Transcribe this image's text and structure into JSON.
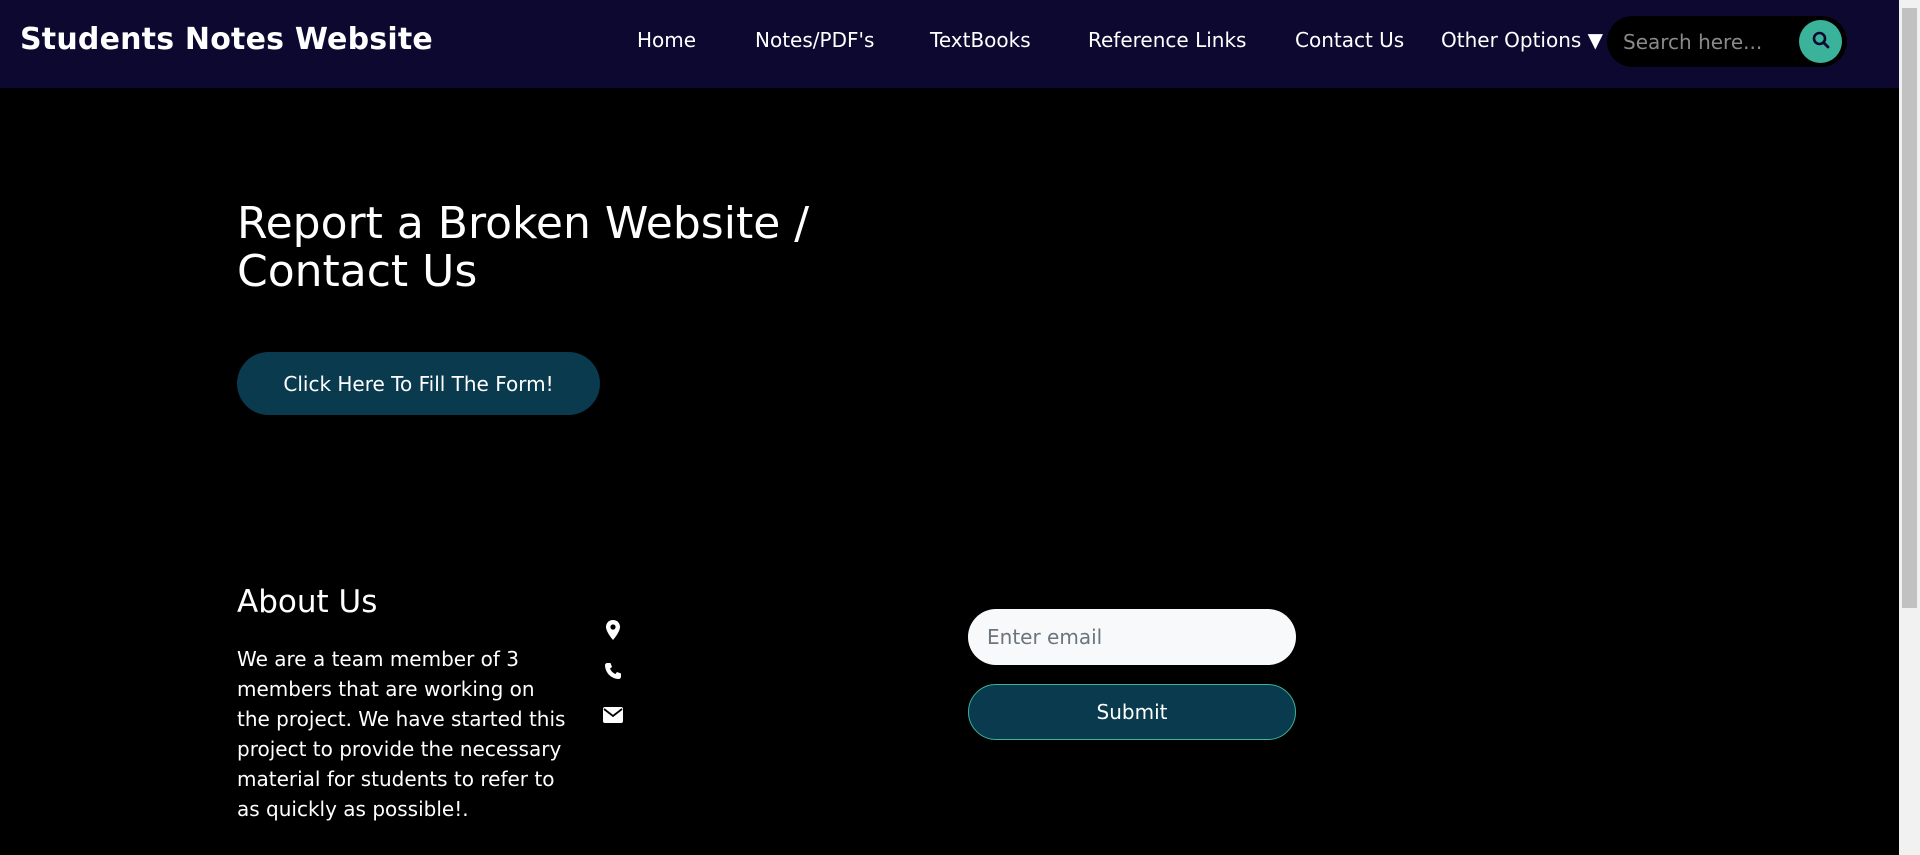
{
  "navbar": {
    "brand": "Students Notes Website",
    "links": [
      {
        "label": "Home"
      },
      {
        "label": "Notes/PDF's"
      },
      {
        "label": "TextBooks"
      },
      {
        "label": "Reference Links"
      },
      {
        "label": "Contact Us"
      },
      {
        "label": "Other Options ▼"
      }
    ],
    "search": {
      "placeholder": "Search here...",
      "value": "",
      "icon": "search-icon"
    },
    "background": "#0c0830"
  },
  "hero": {
    "title": "Report a Broken Website / Contact Us",
    "form_button": "Click Here To Fill The Form!",
    "button_color": "#0a3a4e"
  },
  "about": {
    "title": "About Us",
    "text": "We are a team member of 3 members that are working on the project. We have started this project to provide the necessary material for students to refer to as quickly as possible!.",
    "icons": [
      "map-marker-icon",
      "phone-icon",
      "envelope-icon"
    ]
  },
  "newsletter": {
    "email_placeholder": "Enter email",
    "email_value": "",
    "submit_label": "Submit"
  },
  "colors": {
    "accent": "#3ab39a",
    "page_background": "#000000"
  }
}
